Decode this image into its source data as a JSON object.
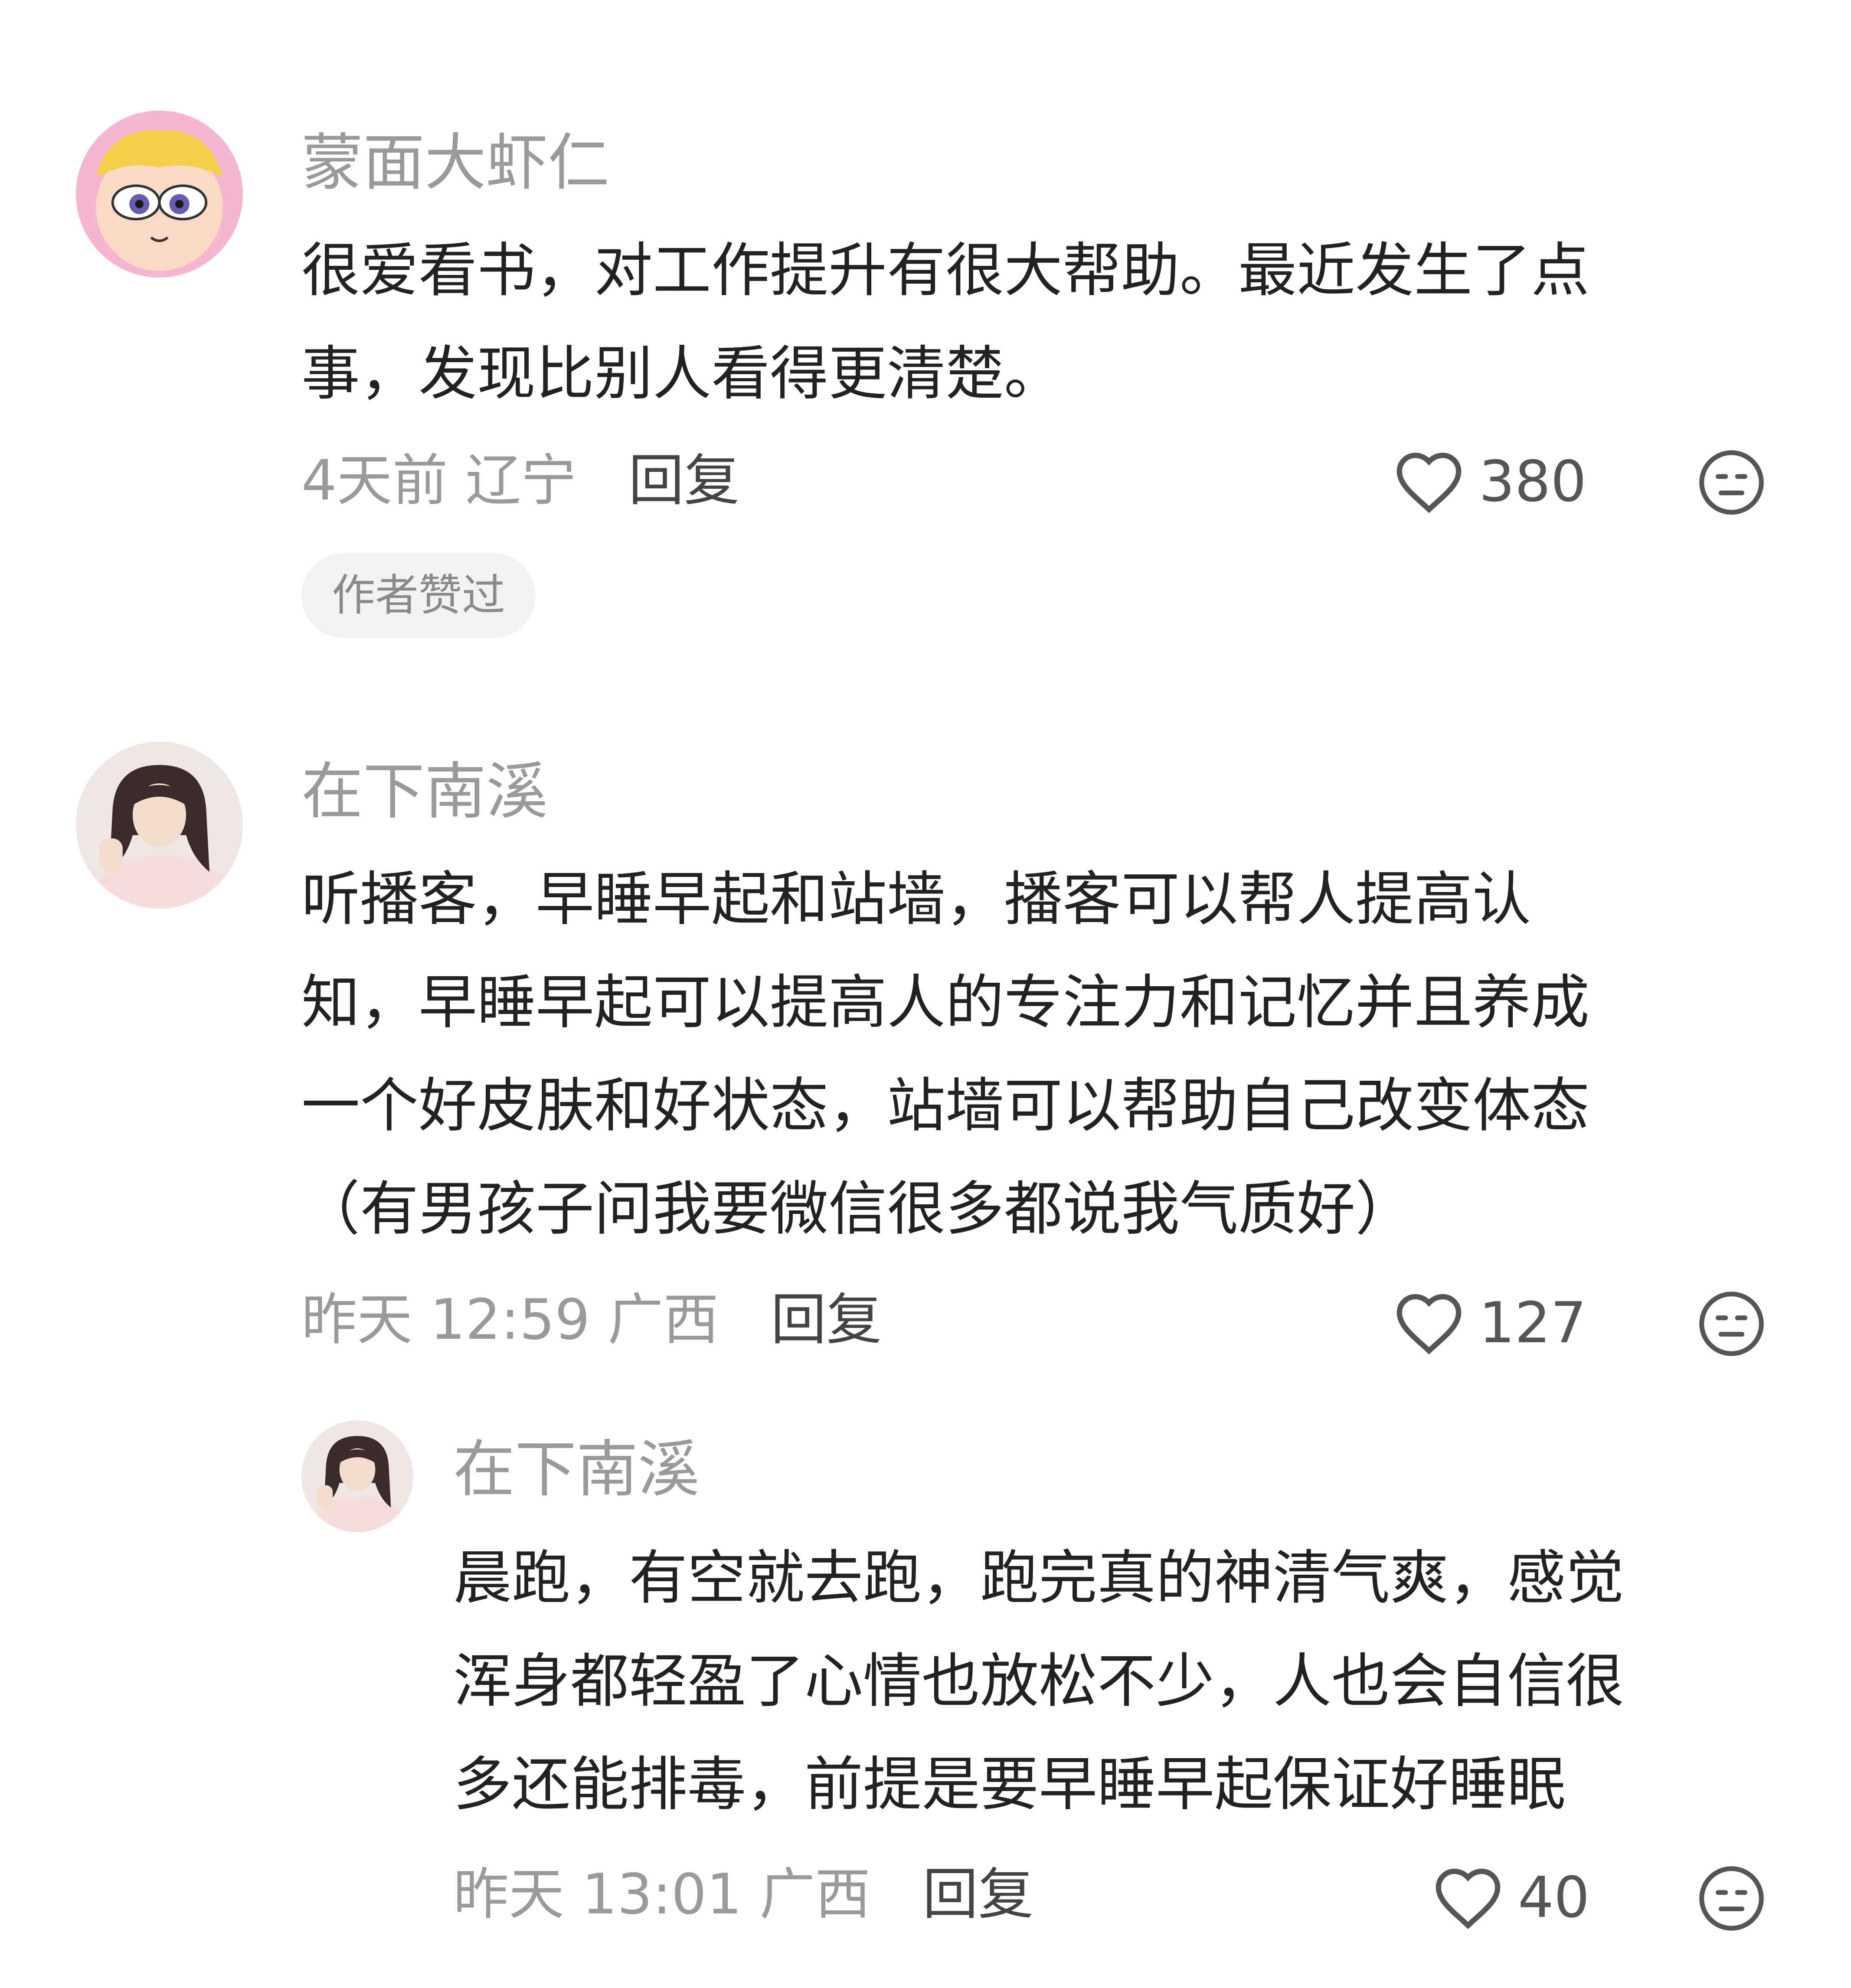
{
  "comments": [
    {
      "username": "蒙面大虾仁",
      "lines": [
        "很爱看书，对工作提升有很大帮助。最近发生了点",
        "事，发现比别人看得更清楚。"
      ],
      "time_location": "4天前 辽宁",
      "reply_label": "回复",
      "likes": "380",
      "badge": "作者赞过"
    },
    {
      "username": "在下南溪",
      "lines": [
        "听播客，早睡早起和站墙，播客可以帮人提高认",
        "知，早睡早起可以提高人的专注力和记忆并且养成",
        "一个好皮肤和好状态，站墙可以帮助自己改变体态",
        "（有男孩子问我要微信很多都说我气质好）"
      ],
      "time_location": "昨天 12:59 广西",
      "reply_label": "回复",
      "likes": "127"
    },
    {
      "username": "在下南溪",
      "lines": [
        "晨跑，有空就去跑，跑完真的神清气爽，感觉",
        "浑身都轻盈了心情也放松不少，人也会自信很",
        "多还能排毒，前提是要早睡早起保证好睡眠"
      ],
      "time_location": "昨天 13:01 广西",
      "reply_label": "回复",
      "likes": "40"
    }
  ],
  "icons": {
    "like": "heart-outline-icon",
    "dislike": "neutral-face-icon"
  },
  "colors": {
    "username": "#9a9a9a",
    "body": "#222222",
    "meta": "#9a9a9a",
    "badge_bg": "#f2f2f2"
  }
}
